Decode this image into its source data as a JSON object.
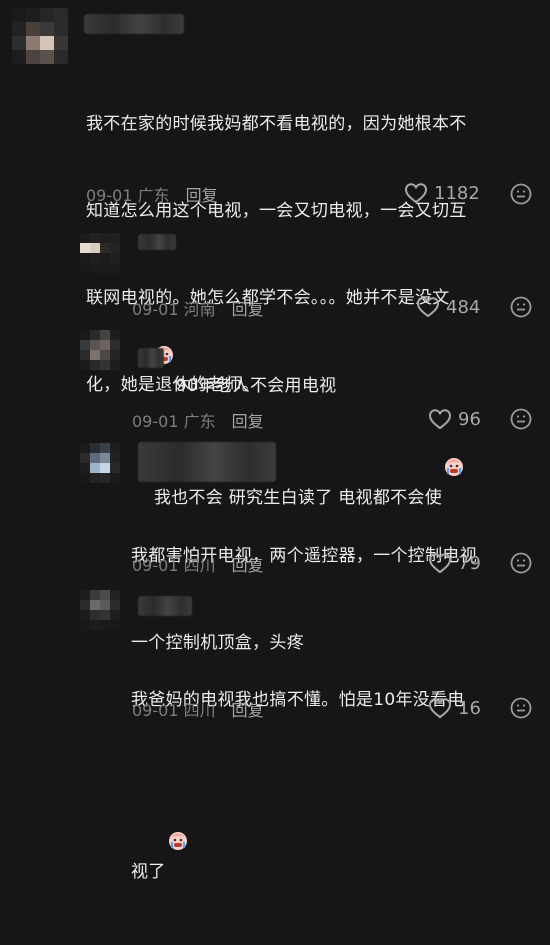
{
  "comments": [
    {
      "text": "我不在家的时候我妈都不看电视的，因为她根本不知道怎么用这个电视，一会又切电视，一会又切互联网电视的。她怎么都学不会。。。她并不是没文化，她是退休的老师。",
      "lines": [
        "我不在家的时候我妈都不看电视的，因为她根本不",
        "知道怎么用这个电视，一会又切电视，一会又切互",
        "联网电视的。她怎么都学不会。。。她并不是没文",
        "化，她是退休的老师。"
      ],
      "date": "09-01",
      "location": "广东",
      "reply": "回复",
      "likes": "1182"
    },
    {
      "lines": [
        "90年老人不会用电视"
      ],
      "date": "09-01",
      "location": "河南",
      "reply": "回复",
      "likes": "484"
    },
    {
      "lines": [
        "我也不会 研究生白读了 电视都不会使"
      ],
      "date": "09-01",
      "location": "广东",
      "reply": "回复",
      "likes": "96"
    },
    {
      "lines": [
        "我都害怕开电视，两个遥控器，一个控制电视",
        "一个控制机顶盒，头疼"
      ],
      "date": "09-01",
      "location": "四川",
      "reply": "回复",
      "likes": "79"
    },
    {
      "lines": [
        "我爸妈的电视我也搞不懂。怕是10年没看电",
        "视了"
      ],
      "date": "09-01",
      "location": "四川",
      "reply": "回复",
      "likes": "16"
    }
  ],
  "icons": {
    "heart": "heart-outline-icon",
    "emoji_reaction": "face-emoji-icon"
  },
  "colors": {
    "background": "#161616",
    "text": "#ececec",
    "meta": "#8a8a8a"
  }
}
